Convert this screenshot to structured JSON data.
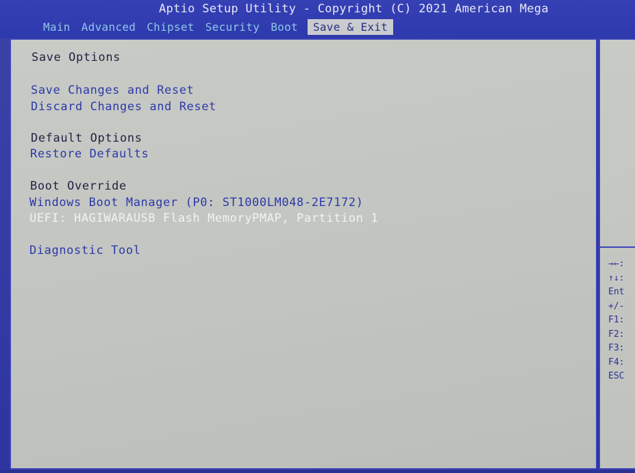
{
  "header": {
    "title": "Aptio Setup Utility - Copyright (C) 2021 American Mega"
  },
  "tabs": [
    {
      "label": "Main",
      "active": false
    },
    {
      "label": "Advanced",
      "active": false
    },
    {
      "label": "Chipset",
      "active": false
    },
    {
      "label": "Security",
      "active": false
    },
    {
      "label": "Boot",
      "active": false
    },
    {
      "label": "Save & Exit",
      "active": true
    }
  ],
  "main": {
    "save_options_heading": "Save Options",
    "save_changes_reset": "Save Changes and Reset",
    "discard_changes_reset": "Discard Changes and Reset",
    "default_options_heading": "Default Options",
    "restore_defaults": "Restore Defaults",
    "boot_override_heading": "Boot Override",
    "boot_windows": "Windows Boot Manager (P0: ST1000LM048-2E7172)",
    "boot_uefi": "UEFI: HAGIWARAUSB Flash MemoryPMAP, Partition 1",
    "diagnostic_tool": "Diagnostic Tool"
  },
  "help": {
    "keys": [
      "→←:",
      "↑↓:",
      "Ent",
      "+/-",
      "F1:",
      "F2:",
      "F3:",
      "F4:",
      "ESC"
    ]
  },
  "colors": {
    "background_blue": "#2f36a0",
    "panel_gray": "#c4c6c2",
    "tab_text": "#8fc7e8",
    "link_text": "#2c3aa8",
    "selected_text": "#f2f3f5"
  }
}
